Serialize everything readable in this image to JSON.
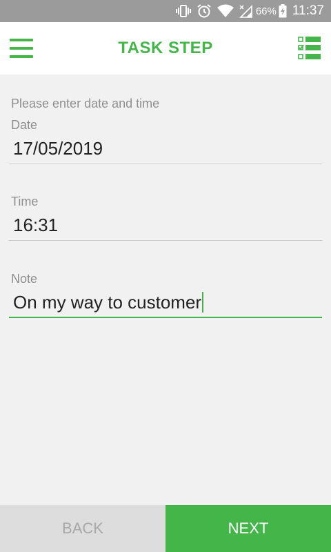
{
  "status_bar": {
    "battery": "66%",
    "time": "11:37",
    "icons": [
      "vibrate-icon",
      "alarm-icon",
      "wifi-icon",
      "signal-icon",
      "battery-charging-icon"
    ]
  },
  "app_bar": {
    "title": "TASK STEP",
    "menu_icon": "hamburger-menu-icon",
    "list_icon": "checklist-icon",
    "accent_color": "#43b549"
  },
  "form": {
    "prompt": "Please enter date and time",
    "date": {
      "label": "Date",
      "value": "17/05/2019"
    },
    "time": {
      "label": "Time",
      "value": "16:31"
    },
    "note": {
      "label": "Note",
      "value": "On my way to customer"
    }
  },
  "footer": {
    "back_label": "BACK",
    "next_label": "NEXT"
  }
}
